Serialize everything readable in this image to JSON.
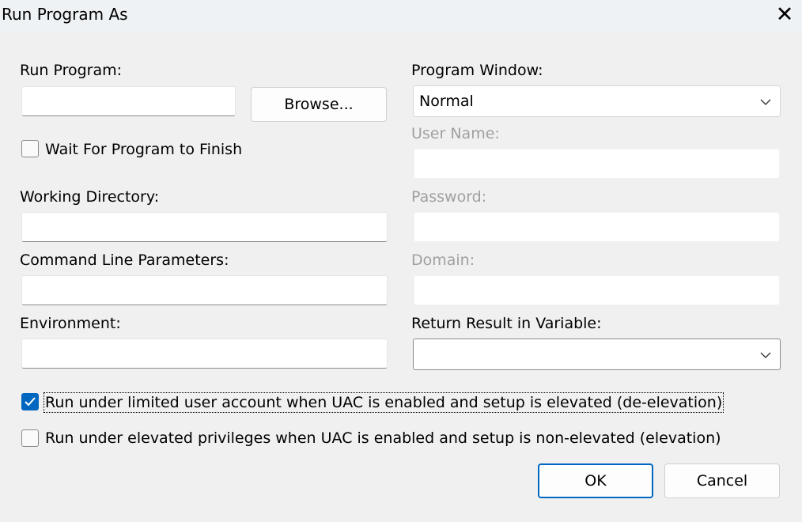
{
  "window": {
    "title": "Run Program As",
    "close_icon": "close-icon"
  },
  "left": {
    "run_program_label": "Run Program:",
    "run_program_value": "",
    "browse_label": "Browse...",
    "wait_label": "Wait For Program to Finish",
    "wait_checked": false,
    "working_directory_label": "Working Directory:",
    "working_directory_value": "",
    "command_line_label": "Command Line Parameters:",
    "command_line_value": "",
    "environment_label": "Environment:",
    "environment_value": ""
  },
  "right": {
    "program_window_label": "Program Window:",
    "program_window_value": "Normal",
    "user_name_label": "User Name:",
    "password_label": "Password:",
    "domain_label": "Domain:",
    "return_result_label": "Return Result in Variable:",
    "return_result_value": ""
  },
  "options": {
    "deelevation_label": "Run under limited user account when UAC is enabled and setup is elevated (de-elevation)",
    "deelevation_checked": true,
    "elevation_label": "Run under elevated privileges when UAC is enabled and setup is non-elevated (elevation)",
    "elevation_checked": false
  },
  "buttons": {
    "ok": "OK",
    "cancel": "Cancel"
  },
  "colors": {
    "accent": "#0067c0",
    "background": "#f0f0f0",
    "disabled_text": "#a0a0a0"
  }
}
